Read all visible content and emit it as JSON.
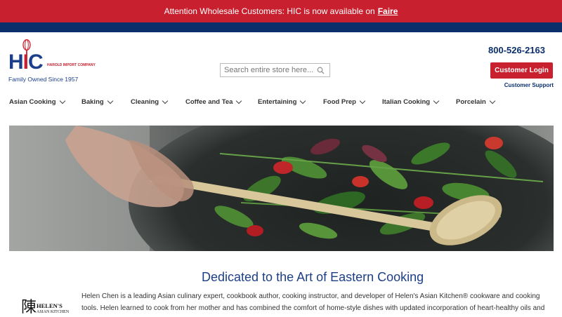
{
  "promo": {
    "text": "Attention Wholesale Customers: HIC is now available on",
    "link": "Faire"
  },
  "logo": {
    "initials_h": "H",
    "initials_i": "I",
    "initials_c": "C",
    "company": "HAROLD IMPORT COMPANY",
    "tagline": "Family Owned Since 1957"
  },
  "search": {
    "placeholder": "Search entire store here..."
  },
  "header": {
    "phone": "800-526-2163",
    "login_label": "Customer Login",
    "support_label": "Customer Support"
  },
  "nav": {
    "items": [
      {
        "label": "Asian Cooking"
      },
      {
        "label": "Baking"
      },
      {
        "label": "Cleaning"
      },
      {
        "label": "Coffee and Tea"
      },
      {
        "label": "Entertaining"
      },
      {
        "label": "Food Prep"
      },
      {
        "label": "Italian Cooking"
      },
      {
        "label": "Porcelain"
      }
    ]
  },
  "intro": {
    "title": "Dedicated to the Art of Eastern Cooking",
    "body": "Helen Chen is a leading Asian culinary expert, cookbook author, cooking instructor, and developer of Helen's Asian Kitchen® cookware and cooking tools. Helen learned to cook from her mother and has combined the comfort of home-style dishes with updated incorporation of heart-healthy oils and",
    "logo_char": "陳",
    "logo_name": "HELEN'S",
    "logo_sub": "ASIAN KITCHEN"
  },
  "colors": {
    "brand_red": "#c8202f",
    "brand_navy": "#0b2f6b",
    "title_blue": "#1d3f8a"
  }
}
